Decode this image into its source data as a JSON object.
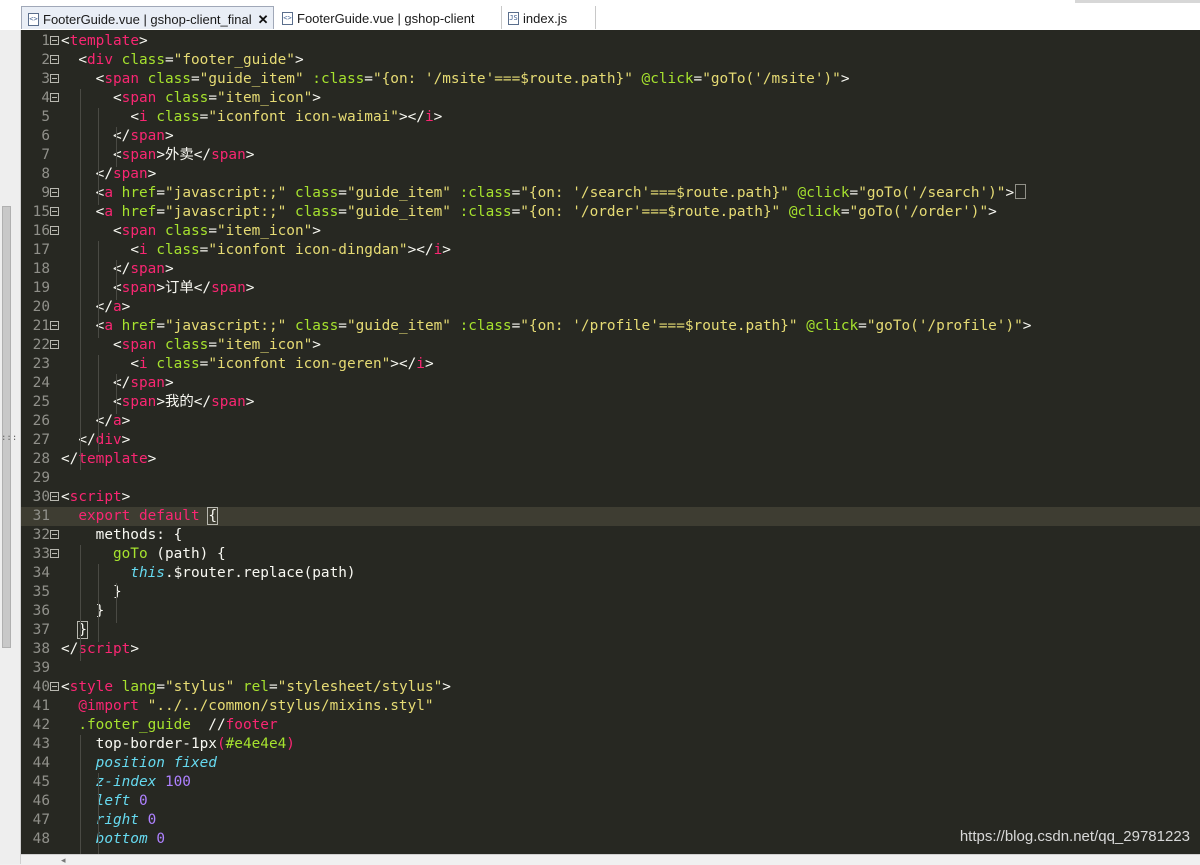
{
  "tabs": [
    {
      "label": "FooterGuide.vue | gshop-client_final",
      "icon": "vue-file-icon",
      "active": true,
      "close": "✕"
    },
    {
      "label": "FooterGuide.vue | gshop-client",
      "icon": "vue-file-icon",
      "active": false
    },
    {
      "label": "index.js",
      "icon": "js-file-icon",
      "active": false
    }
  ],
  "editor": {
    "theme": {
      "background": "#272822",
      "current_line": "#3e3d32",
      "tag": "#f92672",
      "attr": "#a6e22e",
      "string": "#e6db74",
      "number": "#ae81ff",
      "italic_keyword": "#66d9ef"
    },
    "line_numbers": [
      "1",
      "2",
      "3",
      "4",
      "5",
      "6",
      "7",
      "8",
      "9",
      "15",
      "16",
      "17",
      "18",
      "19",
      "20",
      "21",
      "22",
      "23",
      "24",
      "25",
      "26",
      "27",
      "28",
      "29",
      "30",
      "31",
      "32",
      "33",
      "34",
      "35",
      "36",
      "37",
      "38",
      "39",
      "40",
      "41",
      "42",
      "43",
      "44",
      "45",
      "46",
      "47",
      "48"
    ],
    "lines": {
      "l1": {
        "o": "<",
        "tag": "template",
        "c": ">"
      },
      "l2": {
        "o": "<",
        "tag": "div",
        "attr": "class",
        "eq": "=",
        "val": "\"footer_guide\"",
        "c": ">"
      },
      "l3": {
        "o": "<",
        "tag": "span",
        "a1": "class",
        "v1": "\"guide_item\"",
        "a2": ":class",
        "v2": "\"{on: '/msite'===$route.path}\"",
        "a3": "@click",
        "v3": "\"goTo('/msite')\"",
        "c": ">"
      },
      "l4": {
        "o": "<",
        "tag": "span",
        "attr": "class",
        "val": "\"item_icon\"",
        "c": ">"
      },
      "l5": {
        "o": "<",
        "tag": "i",
        "attr": "class",
        "val": "\"iconfont icon-waimai\"",
        "c": "></",
        "ctag": "i",
        "cc": ">"
      },
      "l6": {
        "o": "</",
        "tag": "span",
        "c": ">"
      },
      "l7": {
        "o": "<",
        "tag": "span",
        "m": ">外卖</",
        "ctag": "span",
        "c": ">"
      },
      "l8": {
        "o": "</",
        "tag": "span",
        "c": ">"
      },
      "l9": {
        "o": "<",
        "tag": "a",
        "a1": "href",
        "v1": "\"javascript:;\"",
        "a2": "class",
        "v2": "\"guide_item\"",
        "a3": ":class",
        "v3": "\"{on: '/search'===$route.path}\"",
        "a4": "@click",
        "v4": "\"goTo('/search')\"",
        "c": ">"
      },
      "l15": {
        "o": "<",
        "tag": "a",
        "a1": "href",
        "v1": "\"javascript:;\"",
        "a2": "class",
        "v2": "\"guide_item\"",
        "a3": ":class",
        "v3": "\"{on: '/order'===$route.path}\"",
        "a4": "@click",
        "v4": "\"goTo('/order')\"",
        "c": ">"
      },
      "l16": {
        "o": "<",
        "tag": "span",
        "attr": "class",
        "val": "\"item_icon\"",
        "c": ">"
      },
      "l17": {
        "o": "<",
        "tag": "i",
        "attr": "class",
        "val": "\"iconfont icon-dingdan\"",
        "c": "></",
        "ctag": "i",
        "cc": ">"
      },
      "l18": {
        "o": "</",
        "tag": "span",
        "c": ">"
      },
      "l19": {
        "o": "<",
        "tag": "span",
        "m": ">订单</",
        "ctag": "span",
        "c": ">"
      },
      "l20": {
        "o": "</",
        "tag": "a",
        "c": ">"
      },
      "l21": {
        "o": "<",
        "tag": "a",
        "a1": "href",
        "v1": "\"javascript:;\"",
        "a2": "class",
        "v2": "\"guide_item\"",
        "a3": ":class",
        "v3": "\"{on: '/profile'===$route.path}\"",
        "a4": "@click",
        "v4": "\"goTo('/profile')\"",
        "c": ">"
      },
      "l22": {
        "o": "<",
        "tag": "span",
        "attr": "class",
        "val": "\"item_icon\"",
        "c": ">"
      },
      "l23": {
        "o": "<",
        "tag": "i",
        "attr": "class",
        "val": "\"iconfont icon-geren\"",
        "c": "></",
        "ctag": "i",
        "cc": ">"
      },
      "l24": {
        "o": "</",
        "tag": "span",
        "c": ">"
      },
      "l25": {
        "o": "<",
        "tag": "span",
        "m": ">我的</",
        "ctag": "span",
        "c": ">"
      },
      "l26": {
        "o": "</",
        "tag": "a",
        "c": ">"
      },
      "l27": {
        "o": "</",
        "tag": "div",
        "c": ">"
      },
      "l28": {
        "o": "</",
        "tag": "template",
        "c": ">"
      },
      "l30": {
        "o": "<",
        "tag": "script",
        "c": ">"
      },
      "l31": {
        "k1": "export",
        "k2": "default",
        "b": "{"
      },
      "l32": {
        "t": "methods: {"
      },
      "l33": {
        "f": "goTo",
        "t": " (path) {"
      },
      "l34": {
        "i": "this",
        "t": ".$router.replace(path)"
      },
      "l35": {
        "t": "}"
      },
      "l36": {
        "t": "}"
      },
      "l37": {
        "t": "}"
      },
      "l38": {
        "o": "</",
        "tag": "script",
        "c": ">"
      },
      "l40": {
        "o": "<",
        "tag": "style",
        "a1": "lang",
        "v1": "\"stylus\"",
        "a2": "rel",
        "v2": "\"stylesheet/stylus\"",
        "c": ">"
      },
      "l41": {
        "k": "@import",
        "s": "\"../../common/stylus/mixins.styl\""
      },
      "l42": {
        "f": ".footer_guide",
        "sp": "  ",
        "c1": "//",
        "c2": "footer"
      },
      "l43": {
        "t": "top-border-1px",
        "p1": "(",
        "arg": "#e4e4e4",
        "p2": ")"
      },
      "l44": {
        "i1": "position",
        "i2": "fixed"
      },
      "l45": {
        "i1": "z-index",
        "n": "100"
      },
      "l46": {
        "i1": "left",
        "n": "0"
      },
      "l47": {
        "i1": "right",
        "n": "0"
      },
      "l48": {
        "i1": "bottom",
        "n": "0"
      }
    }
  },
  "watermark": "https://blog.csdn.net/qq_29781223"
}
